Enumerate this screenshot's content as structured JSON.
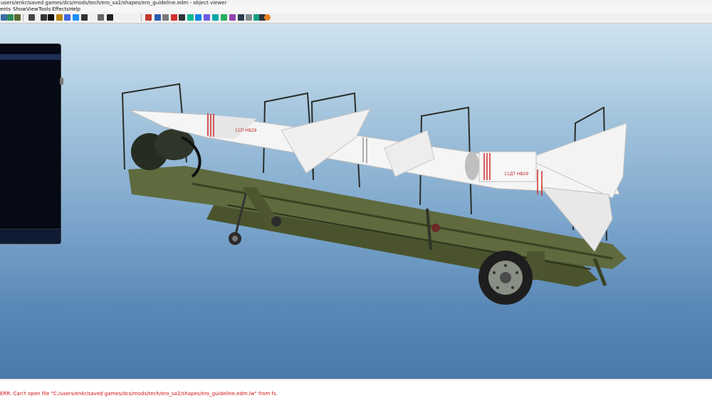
{
  "window": {
    "title": "users/enkr/saved games/dcs/mods/tech/ero_sa2/shapes/ero_guideline.edm - object viewer"
  },
  "menu": {
    "items": [
      {
        "label": "ents"
      },
      {
        "label": "Show"
      },
      {
        "label": "View"
      },
      {
        "label": "Tools"
      },
      {
        "label": "Effects"
      },
      {
        "label": "Help"
      }
    ]
  },
  "toolbar": {
    "buttons": [
      {
        "icon": "grid-icon",
        "color": "#3a6ea5"
      },
      {
        "icon": "table-icon",
        "color": "#2e8b57"
      },
      {
        "icon": "layers-icon",
        "color": "#556b2f"
      },
      {
        "icon": "node-icon",
        "color": "#444444"
      },
      {
        "icon": "plus-icon",
        "color": "#333333"
      },
      {
        "icon": "black-square-icon",
        "color": "#111111"
      },
      {
        "icon": "lamp-icon",
        "color": "#b8860b"
      },
      {
        "icon": "funnel-icon",
        "color": "#4169e1"
      },
      {
        "icon": "person-icon",
        "color": "#1e90ff"
      },
      {
        "icon": "light-icon",
        "color": "#333333"
      },
      {
        "icon": "dot-icon",
        "color": "#666666"
      },
      {
        "icon": "eye-icon",
        "color": "#222222"
      },
      {
        "icon": "chart-icon",
        "color": "#c0392b"
      },
      {
        "icon": "list-icon",
        "color": "#2a5db0"
      },
      {
        "icon": "material-icon",
        "color": "#7a7a7a"
      },
      {
        "icon": "cube-icon",
        "color": "#d63031"
      },
      {
        "icon": "cube-shaded-icon",
        "color": "#2d3436"
      },
      {
        "icon": "texture-icon",
        "color": "#00b894"
      },
      {
        "icon": "wire-icon",
        "color": "#0984e3"
      },
      {
        "icon": "normal-icon",
        "color": "#6c5ce7"
      },
      {
        "icon": "points-icon",
        "color": "#00a8a8"
      },
      {
        "icon": "grid-toggle-icon",
        "color": "#27ae60"
      },
      {
        "icon": "matrix-icon",
        "color": "#8e44ad"
      },
      {
        "icon": "arrow-icon",
        "color": "#2c3e50"
      },
      {
        "icon": "bones-icon",
        "color": "#7f8c8d"
      },
      {
        "icon": "frame-icon",
        "color": "#16a085"
      },
      {
        "icon": "camera-icon",
        "color": "#2d3436"
      },
      {
        "icon": "sun-icon",
        "color": "#e67e22"
      }
    ]
  },
  "viewport": {
    "marking_a": "11П НВ29",
    "marking_b": "11ДТ НВ29"
  },
  "status": {
    "message": "ERR: Can't open file \"C:/users/enkr/saved games/dcs/mods/tech/ero_sa2/shapes/ero_guideline.edm.lw\" from fs."
  }
}
